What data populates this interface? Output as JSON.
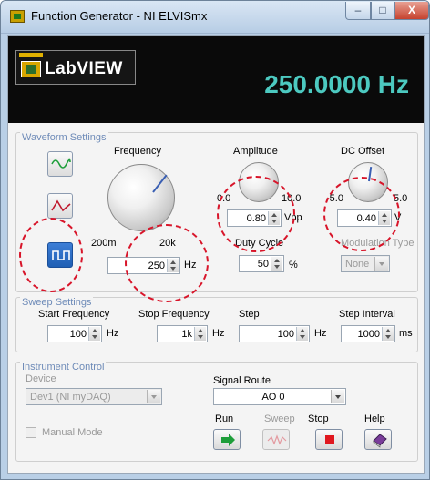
{
  "window": {
    "title": "Function Generator - NI ELVISmx",
    "min_icon": "minimize-icon",
    "max_icon": "maximize-icon",
    "close_icon": "close-icon",
    "min_glyph": "–",
    "max_glyph": "□",
    "close_glyph": "X"
  },
  "banner": {
    "logo_text": "LabVIEW",
    "frequency_readout": "250.0000 Hz",
    "readout_color": "#4cc9c0"
  },
  "waveform_settings": {
    "title": "Waveform Settings",
    "waveforms": [
      {
        "name": "sine-wave-icon",
        "selected": false
      },
      {
        "name": "triangle-wave-icon",
        "selected": false
      },
      {
        "name": "square-wave-icon",
        "selected": true
      }
    ],
    "frequency": {
      "label": "Frequency",
      "range_min": "200m",
      "range_max": "20k",
      "value": "250",
      "unit": "Hz"
    },
    "amplitude": {
      "label": "Amplitude",
      "range_min": "0.0",
      "range_max": "10.0",
      "value": "0.80",
      "unit": "Vpp"
    },
    "dc_offset": {
      "label": "DC Offset",
      "range_min": "-5.0",
      "range_max": "5.0",
      "value": "0.40",
      "unit": "V"
    },
    "duty_cycle": {
      "label": "Duty Cycle",
      "value": "50",
      "unit": "%"
    },
    "modulation_type": {
      "label": "Modulation Type",
      "value": "None"
    }
  },
  "sweep_settings": {
    "title": "Sweep Settings",
    "start_frequency": {
      "label": "Start Frequency",
      "value": "100",
      "unit": "Hz"
    },
    "stop_frequency": {
      "label": "Stop Frequency",
      "value": "1k",
      "unit": "Hz"
    },
    "step": {
      "label": "Step",
      "value": "100",
      "unit": "Hz"
    },
    "step_interval": {
      "label": "Step Interval",
      "value": "1000",
      "unit": "ms"
    }
  },
  "instrument_control": {
    "title": "Instrument Control",
    "device_label": "Device",
    "device_value": "Dev1 (NI myDAQ)",
    "signal_route_label": "Signal Route",
    "signal_route_value": "AO 0",
    "manual_mode_label": "Manual Mode",
    "run_label": "Run",
    "sweep_label": "Sweep",
    "stop_label": "Stop",
    "help_label": "Help",
    "run_icon": "run-arrow-icon",
    "sweep_icon": "sweep-icon",
    "stop_icon": "stop-icon",
    "help_icon": "help-book-icon"
  },
  "colors": {
    "accent_blue": "#1f5fb4",
    "group_title": "#6e8bb8",
    "annotation_red": "#d8152a",
    "run_green": "#1e9e3a",
    "stop_red": "#e0181f"
  }
}
